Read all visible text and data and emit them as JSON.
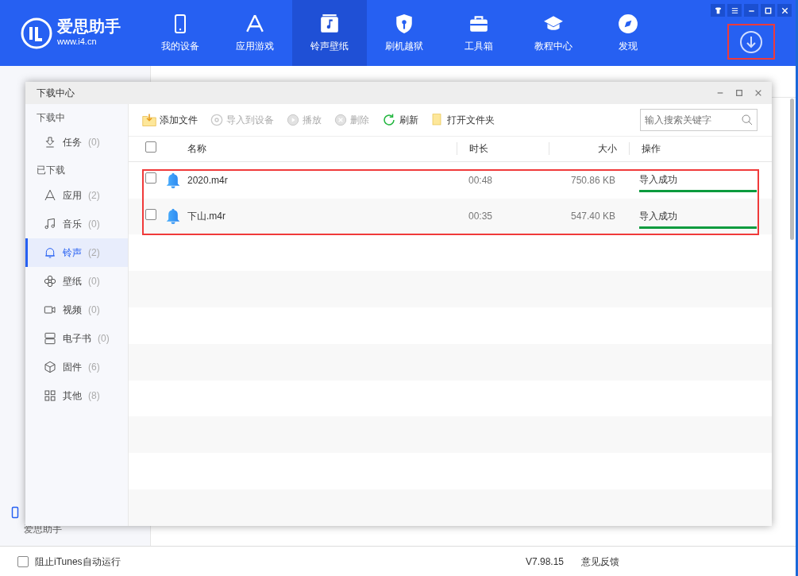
{
  "app": {
    "logo_title": "爱思助手",
    "logo_url": "www.i4.cn",
    "nav": [
      {
        "label": "我的设备",
        "selected": false
      },
      {
        "label": "应用游戏",
        "selected": false
      },
      {
        "label": "铃声壁纸",
        "selected": true
      },
      {
        "label": "刷机越狱",
        "selected": false
      },
      {
        "label": "工具箱",
        "selected": false
      },
      {
        "label": "教程中心",
        "selected": false
      },
      {
        "label": "发现",
        "selected": false
      }
    ]
  },
  "background": {
    "device_label": "爱思助手"
  },
  "dialog": {
    "title": "下载中心",
    "sidebar": [
      {
        "heading": "下载中",
        "items": [
          {
            "label": "任务",
            "count": "(0)",
            "selected": false
          }
        ]
      },
      {
        "heading": "已下载",
        "items": [
          {
            "label": "应用",
            "count": "(2)",
            "selected": false
          },
          {
            "label": "音乐",
            "count": "(0)",
            "selected": false
          },
          {
            "label": "铃声",
            "count": "(2)",
            "selected": true
          },
          {
            "label": "壁纸",
            "count": "(0)",
            "selected": false
          },
          {
            "label": "视频",
            "count": "(0)",
            "selected": false
          },
          {
            "label": "电子书",
            "count": "(0)",
            "selected": false
          },
          {
            "label": "固件",
            "count": "(6)",
            "selected": false
          },
          {
            "label": "其他",
            "count": "(8)",
            "selected": false
          }
        ]
      }
    ],
    "toolbar": [
      {
        "label": "添加文件",
        "disabled": false
      },
      {
        "label": "导入到设备",
        "disabled": true
      },
      {
        "label": "播放",
        "disabled": true
      },
      {
        "label": "删除",
        "disabled": true
      },
      {
        "label": "刷新",
        "disabled": false
      },
      {
        "label": "打开文件夹",
        "disabled": false
      }
    ],
    "search": {
      "placeholder": "输入搜索关键字"
    },
    "select_all_checked": false,
    "columns": [
      "名称",
      "时长",
      "大小",
      "操作"
    ],
    "rows": [
      {
        "name": "2020.m4r",
        "duration": "00:48",
        "size": "750.86 KB",
        "status": "导入成功",
        "level": 1,
        "checked": false
      },
      {
        "name": "下山.m4r",
        "duration": "00:35",
        "size": "547.40 KB",
        "status": "导入成功",
        "level": 1,
        "checked": false
      }
    ]
  },
  "status_bar": {
    "itunes_checkbox": {
      "label": "阻止iTunes自动运行",
      "checked": false
    },
    "version": "V7.98.15",
    "feedback": "意见反馈"
  }
}
